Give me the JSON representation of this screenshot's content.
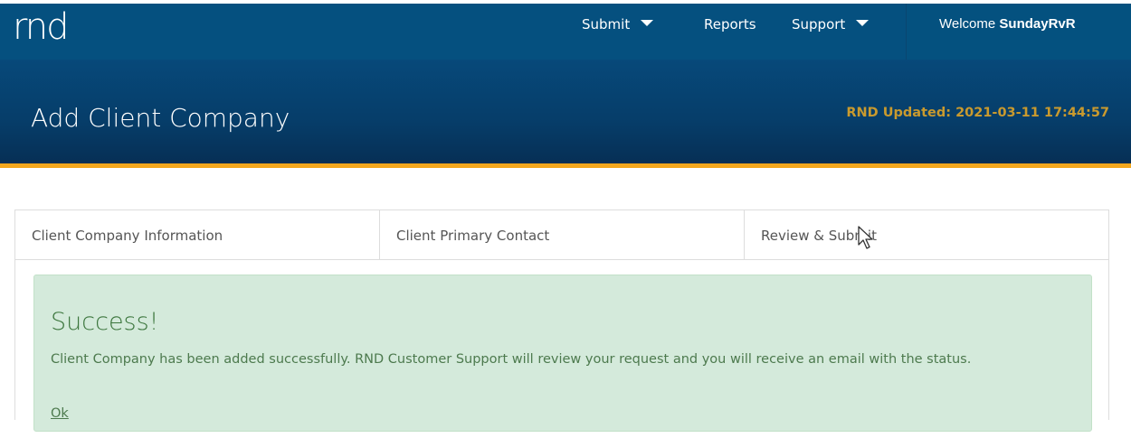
{
  "app": {
    "logo": "rnd"
  },
  "nav": {
    "items": [
      {
        "label": "Submit",
        "has_dropdown": true
      },
      {
        "label": "Reports",
        "has_dropdown": false
      },
      {
        "label": "Support",
        "has_dropdown": true
      }
    ],
    "welcome_prefix": "Welcome",
    "username": "SundayRvR"
  },
  "header": {
    "title": "Add Client Company",
    "updated": "RND Updated: 2021-03-11 17:44:57"
  },
  "wizard": {
    "tabs": [
      {
        "label": "Client Company Information"
      },
      {
        "label": "Client Primary Contact"
      },
      {
        "label": "Review & Submit"
      }
    ]
  },
  "alert": {
    "title": "Success!",
    "message": "Client Company has been added successfully.  RND Customer Support will review your request and you will receive an email with the status.",
    "link": "Ok"
  },
  "colors": {
    "nav_bg": "#05507f",
    "header_bg": "#063d69",
    "accent": "#f3a71e",
    "updated_text": "#c99a2e",
    "success_bg": "#d4eadb",
    "success_text": "#3c763d"
  },
  "icons": {
    "dropdown": "caret-down-icon",
    "cursor": "mouse-pointer-icon"
  }
}
